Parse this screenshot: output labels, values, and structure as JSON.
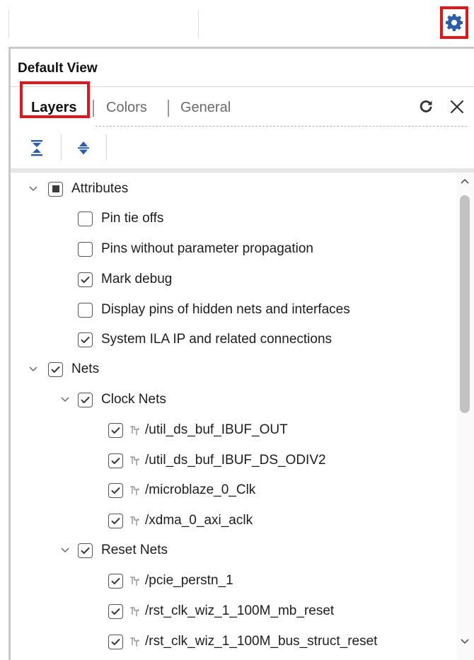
{
  "panel": {
    "title": "Default View",
    "tabs": [
      {
        "label": "Layers",
        "active": true
      },
      {
        "label": "Colors",
        "active": false
      },
      {
        "label": "General",
        "active": false
      }
    ],
    "actions": {
      "refresh_icon": "refresh-icon",
      "close_icon": "close-icon"
    },
    "toolbar": [
      {
        "name": "collapse-all-icon"
      },
      {
        "name": "expand-all-icon"
      }
    ]
  },
  "header": {
    "settings_icon": "gear-icon"
  },
  "tree": [
    {
      "label": "Attributes",
      "level": 0,
      "expandable": true,
      "state": "partial"
    },
    {
      "label": "Pin tie offs",
      "level": 1,
      "state": "unchecked"
    },
    {
      "label": "Pins without parameter propagation",
      "level": 1,
      "state": "unchecked"
    },
    {
      "label": "Mark debug",
      "level": 1,
      "state": "checked"
    },
    {
      "label": "Display pins of hidden nets and interfaces",
      "level": 1,
      "state": "unchecked"
    },
    {
      "label": "System ILA IP and related connections",
      "level": 1,
      "state": "checked"
    },
    {
      "label": "Nets",
      "level": 0,
      "expandable": true,
      "state": "checked"
    },
    {
      "label": "Clock Nets",
      "level": 1,
      "expandable": true,
      "state": "checked"
    },
    {
      "label": "/util_ds_buf_IBUF_OUT",
      "level": 2,
      "state": "checked",
      "icon": "net-icon"
    },
    {
      "label": "/util_ds_buf_IBUF_DS_ODIV2",
      "level": 2,
      "state": "checked",
      "icon": "net-icon"
    },
    {
      "label": "/microblaze_0_Clk",
      "level": 2,
      "state": "checked",
      "icon": "net-icon"
    },
    {
      "label": "/xdma_0_axi_aclk",
      "level": 2,
      "state": "checked",
      "icon": "net-icon"
    },
    {
      "label": "Reset Nets",
      "level": 1,
      "expandable": true,
      "state": "checked"
    },
    {
      "label": "/pcie_perstn_1",
      "level": 2,
      "state": "checked",
      "icon": "net-icon"
    },
    {
      "label": "/rst_clk_wiz_1_100M_mb_reset",
      "level": 2,
      "state": "checked",
      "icon": "net-icon"
    },
    {
      "label": "/rst_clk_wiz_1_100M_bus_struct_reset",
      "level": 2,
      "state": "checked",
      "icon": "net-icon"
    }
  ],
  "colors": {
    "highlight": "#e0161c",
    "gear": "#2b5ea8",
    "text": "#1d1d1d",
    "muted": "#6b6b6b"
  }
}
